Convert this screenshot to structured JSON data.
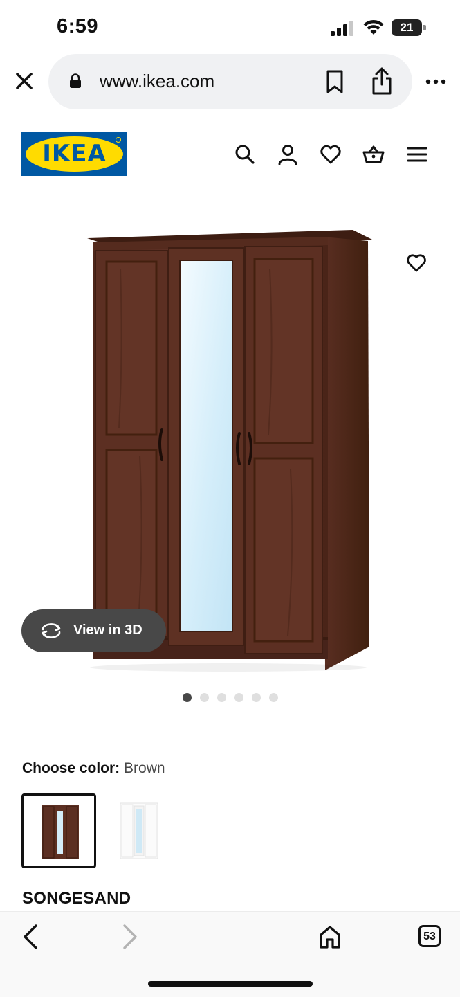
{
  "status_bar": {
    "time": "6:59",
    "battery_level": "21",
    "icons": [
      "cellular-signal-icon",
      "wifi-icon",
      "battery-icon"
    ]
  },
  "browser": {
    "url": "www.ikea.com",
    "icons": [
      "close-icon",
      "lock-icon",
      "bookmark-icon",
      "share-icon",
      "more-icon"
    ]
  },
  "site_header": {
    "logo_text": "IKEA",
    "brand_colors": {
      "blue": "#0058a3",
      "yellow": "#ffdb00"
    },
    "icons": [
      "search-icon",
      "user-icon",
      "heart-icon",
      "basket-icon",
      "menu-icon"
    ]
  },
  "product": {
    "view_3d_label": "View in 3D",
    "carousel": {
      "total": 6,
      "active": 1
    },
    "color_label": "Choose color:",
    "color_value": "Brown",
    "color_options": [
      "Brown",
      "White"
    ],
    "name": "SONGESAND"
  },
  "toolbar": {
    "tab_count": "53",
    "icons": [
      "back-icon",
      "forward-icon",
      "home-icon",
      "tabs-icon"
    ]
  },
  "colors": {
    "wood_brown": "#5a2f22",
    "pill_dark": "#484848",
    "url_bar_bg": "#f0f1f3"
  }
}
